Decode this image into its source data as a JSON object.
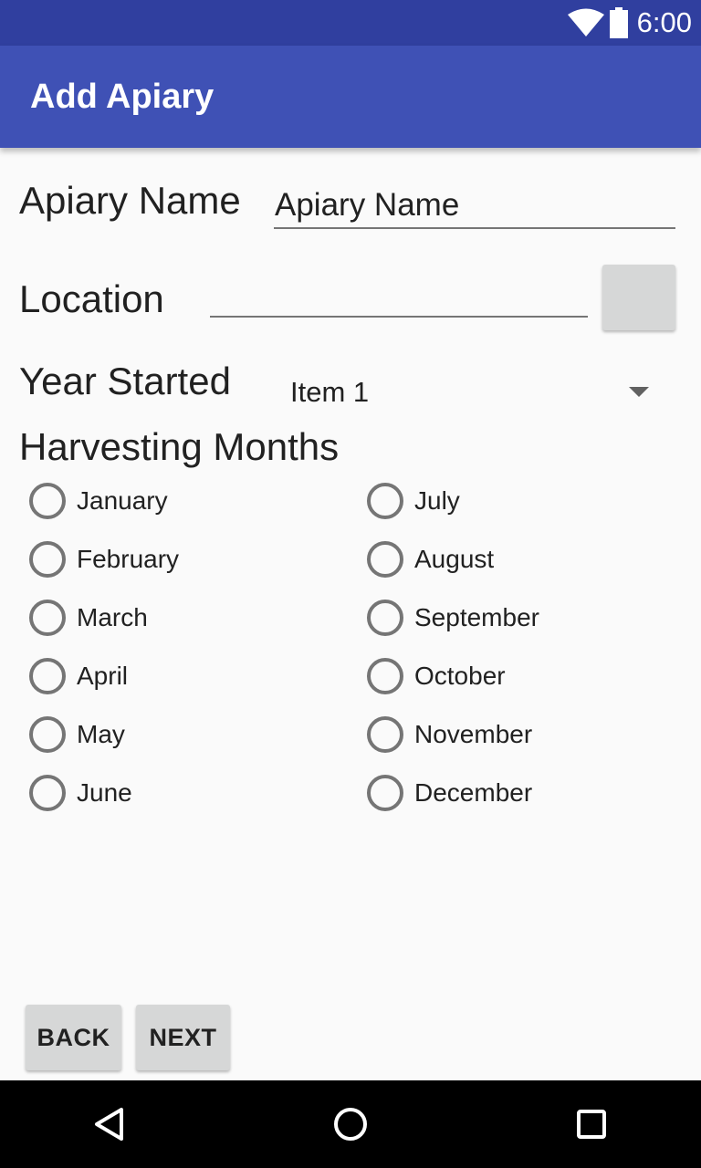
{
  "status_bar": {
    "time": "6:00",
    "icons": [
      "wifi-icon",
      "battery-icon"
    ]
  },
  "app_bar": {
    "title": "Add Apiary"
  },
  "form": {
    "apiary_name_label": "Apiary Name",
    "apiary_name_value": "Apiary Name",
    "location_label": "Location",
    "location_value": "",
    "year_started_label": "Year Started",
    "year_started_value": "Item 1",
    "harvesting_months_label": "Harvesting Months",
    "months_left": [
      "January",
      "February",
      "March",
      "April",
      "May",
      "June"
    ],
    "months_right": [
      "July",
      "August",
      "September",
      "October",
      "November",
      "December"
    ]
  },
  "buttons": {
    "back": "BACK",
    "next": "NEXT"
  },
  "nav_bar": {
    "icons": [
      "back-icon",
      "home-icon",
      "recents-icon"
    ]
  },
  "colors": {
    "status_bar": "#303F9F",
    "app_bar": "#3F51B5",
    "background": "#FAFAFA",
    "button": "#D6D7D7"
  }
}
